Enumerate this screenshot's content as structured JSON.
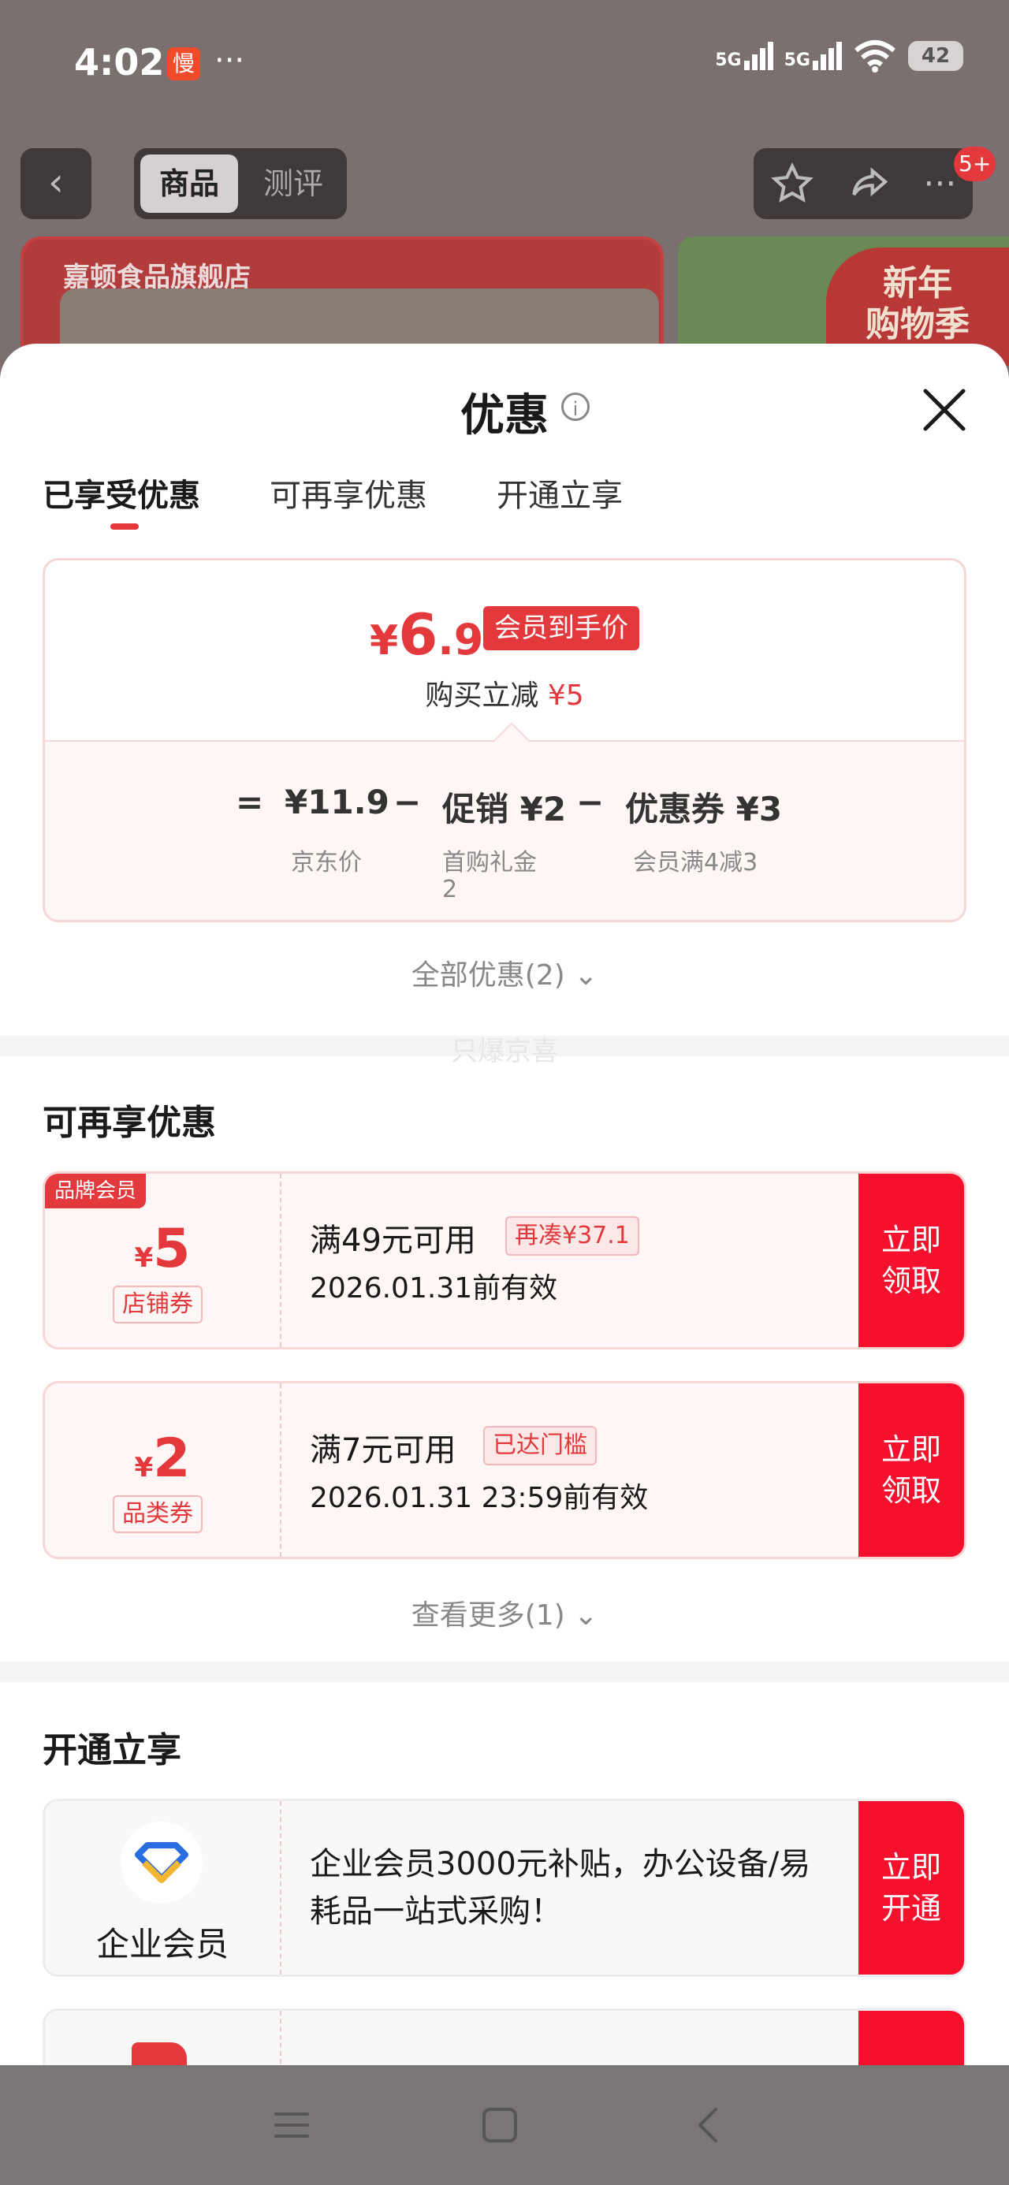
{
  "status_bar": {
    "time": "4:02",
    "app_badge": "慢",
    "more": "···",
    "network1": "5G",
    "network2": "5G",
    "battery": "42"
  },
  "nav": {
    "tabs": [
      {
        "label": "商品"
      },
      {
        "label": "测评"
      }
    ],
    "badge": "5+"
  },
  "banner": {
    "store_name": "嘉顿食品旗舰店",
    "promo_line1": "新年",
    "promo_line2": "购物季"
  },
  "sheet": {
    "title": "优惠",
    "info_icon": "i",
    "tabs": [
      {
        "label": "已享受优惠",
        "active": true
      },
      {
        "label": "可再享优惠",
        "active": false
      },
      {
        "label": "开通立享",
        "active": false
      }
    ]
  },
  "price_card": {
    "currency": "¥",
    "price_int": "6",
    "price_dec": ".9",
    "member_tag": "会员到手价",
    "reduce_label": "购买立减",
    "reduce_amount": "¥5",
    "formula": {
      "eq": "=",
      "jd_price": "¥11.9",
      "jd_label": "京东价",
      "minus1": "−",
      "promo": "促销 ¥2",
      "promo_label_line1": "首购礼金",
      "promo_label_line2": "2",
      "minus2": "−",
      "coupon": "优惠券 ¥3",
      "coupon_label": "会员满4减3"
    }
  },
  "all_offers": {
    "label": "全部优惠(2)",
    "chevron": "⌄"
  },
  "watermark": "只爆京喜",
  "more_offers": {
    "title": "可再享优惠",
    "coupons": [
      {
        "brand_tag": "品牌会员",
        "currency": "¥",
        "amount": "5",
        "kind": "店铺券",
        "condition": "满49元可用",
        "hint": "再凑¥37.1",
        "expire": "2026.01.31前有效",
        "claim_line1": "立即",
        "claim_line2": "领取"
      },
      {
        "brand_tag": "",
        "currency": "¥",
        "amount": "2",
        "kind": "品类券",
        "condition": "满7元可用",
        "hint": "已达门槛",
        "expire": "2026.01.31 23:59前有效",
        "claim_line1": "立即",
        "claim_line2": "领取"
      }
    ],
    "see_more": "查看更多(1)"
  },
  "open_section": {
    "title": "开通立享",
    "card": {
      "name": "企业会员",
      "desc": "企业会员3000元补贴，办公设备/易耗品一站式采购！",
      "claim_line1": "立即",
      "claim_line2": "开通"
    }
  },
  "colors": {
    "accent": "#e4393c",
    "claim_bg": "#f5112e",
    "coupon_bg": "#fff6f6"
  }
}
